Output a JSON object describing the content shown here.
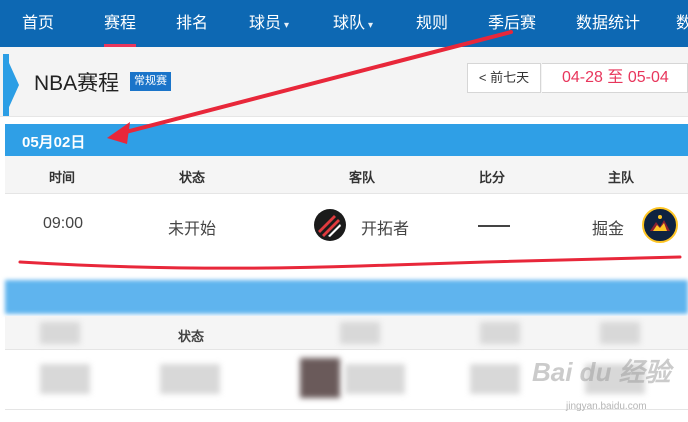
{
  "nav": {
    "items": [
      {
        "label": "首页"
      },
      {
        "label": "赛程"
      },
      {
        "label": "排名"
      },
      {
        "label": "球员"
      },
      {
        "label": "球队"
      },
      {
        "label": "规则"
      },
      {
        "label": "季后赛"
      },
      {
        "label": "数据统计"
      },
      {
        "label": "数"
      }
    ],
    "active_label": "赛程",
    "caret_icon": "chevron-down-icon"
  },
  "header": {
    "title": "NBA赛程",
    "badge": "常规赛",
    "prev_button": "< 前七天",
    "date_range": "04-28 至 05-04"
  },
  "schedule": {
    "date": "05月02日",
    "columns": [
      "时间",
      "状态",
      "客队",
      "比分",
      "主队"
    ],
    "games": [
      {
        "time": "09:00",
        "status": "未开始",
        "away_team": "开拓者",
        "away_logo": "trail-blazers-logo",
        "score": "——",
        "home_team": "掘金",
        "home_logo": "nuggets-logo"
      }
    ]
  },
  "blurred_section": {
    "header_label": "状态"
  },
  "watermark": {
    "text": "Bai du 经验",
    "sub": "jingyan.baidu.com"
  },
  "colors": {
    "nav_bg": "#0d68b3",
    "active_underline": "#e8365c",
    "date_bar": "#2f9fe6",
    "badge": "#1a74c9",
    "date_range_text": "#e8365c",
    "annotation": "#e8273a"
  }
}
